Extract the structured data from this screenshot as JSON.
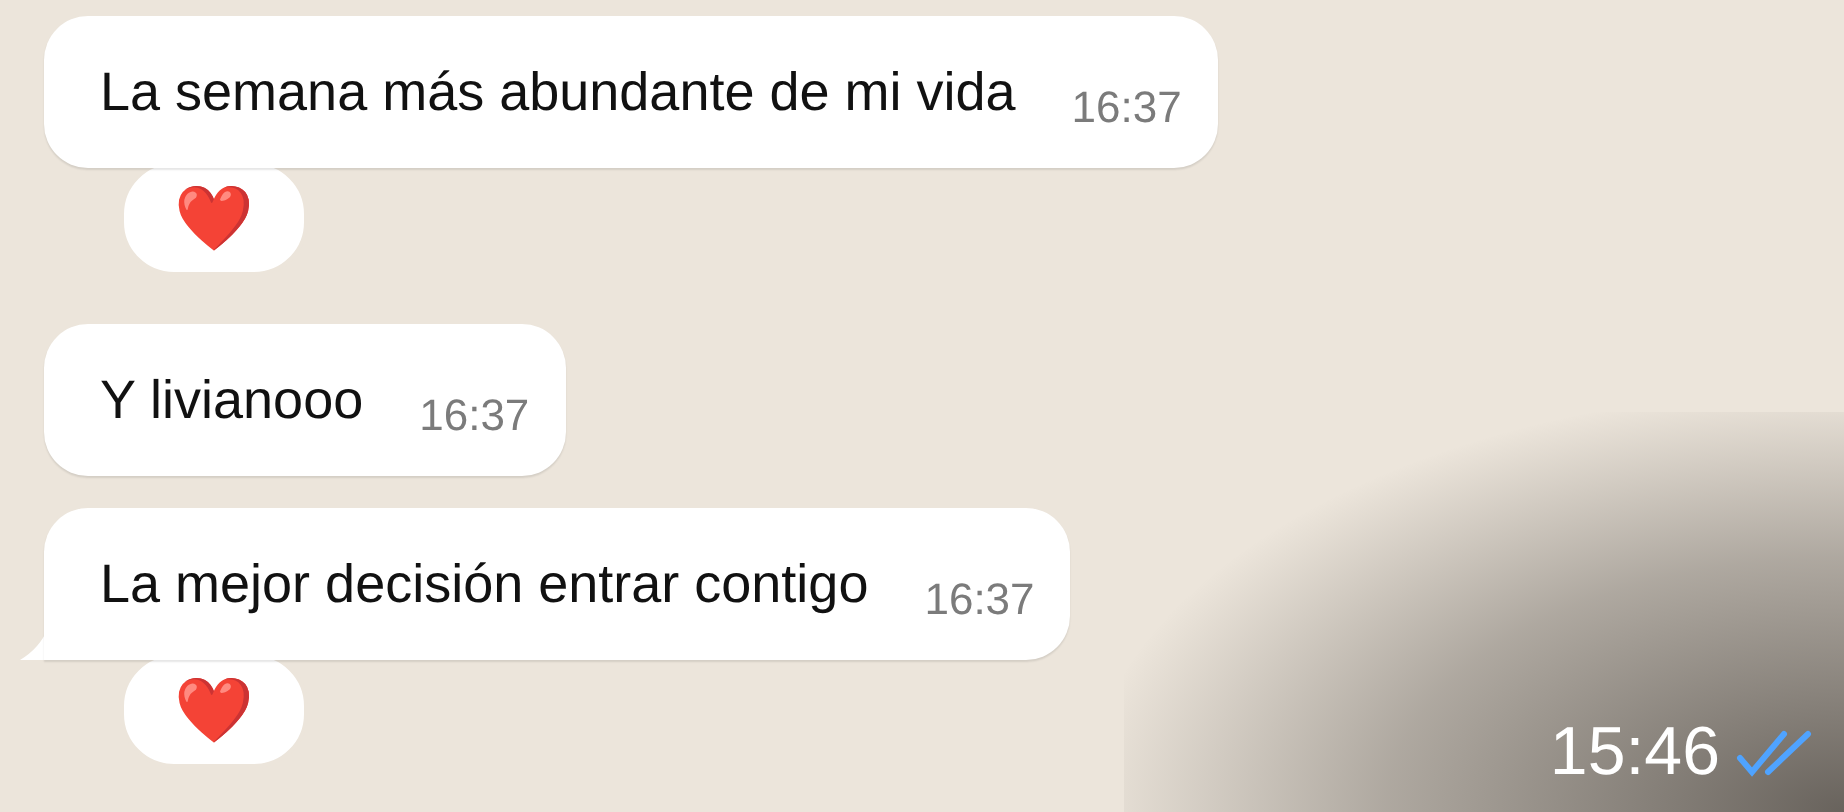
{
  "messages": [
    {
      "text": "La semana más abundante de mi vida",
      "time": "16:37",
      "tail": false,
      "reaction": "❤️"
    },
    {
      "text": "Y livianooo",
      "time": "16:37",
      "tail": false
    },
    {
      "text": "La mejor decisión entrar contigo",
      "time": "16:37",
      "tail": true,
      "reaction": "❤️"
    }
  ],
  "overlay": {
    "time": "15:46",
    "read": true
  }
}
